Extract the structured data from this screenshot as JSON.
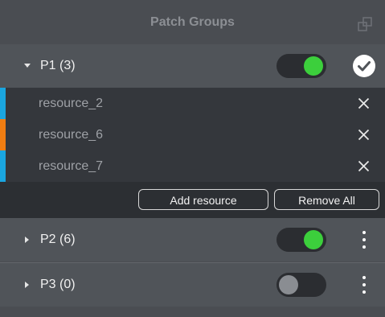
{
  "panel": {
    "title": "Patch Groups",
    "popout_icon": "popout-window-icon"
  },
  "groups": [
    {
      "label": "P1 (3)",
      "expanded": true,
      "enabled": true,
      "action_icon": "checkmark-circle-icon"
    },
    {
      "label": "P2 (6)",
      "expanded": false,
      "enabled": true,
      "action_icon": "kebab-menu-icon"
    },
    {
      "label": "P3 (0)",
      "expanded": false,
      "enabled": false,
      "action_icon": "kebab-menu-icon"
    }
  ],
  "resources": [
    {
      "name": "resource_2",
      "color": "#1aa6e0"
    },
    {
      "name": "resource_6",
      "color": "#f07d12"
    },
    {
      "name": "resource_7",
      "color": "#1aa6e0"
    }
  ],
  "actions": {
    "add_label": "Add resource",
    "remove_all_label": "Remove All"
  },
  "colors": {
    "toggle_on": "#3ccf3c",
    "toggle_off": "#8a8d92"
  }
}
